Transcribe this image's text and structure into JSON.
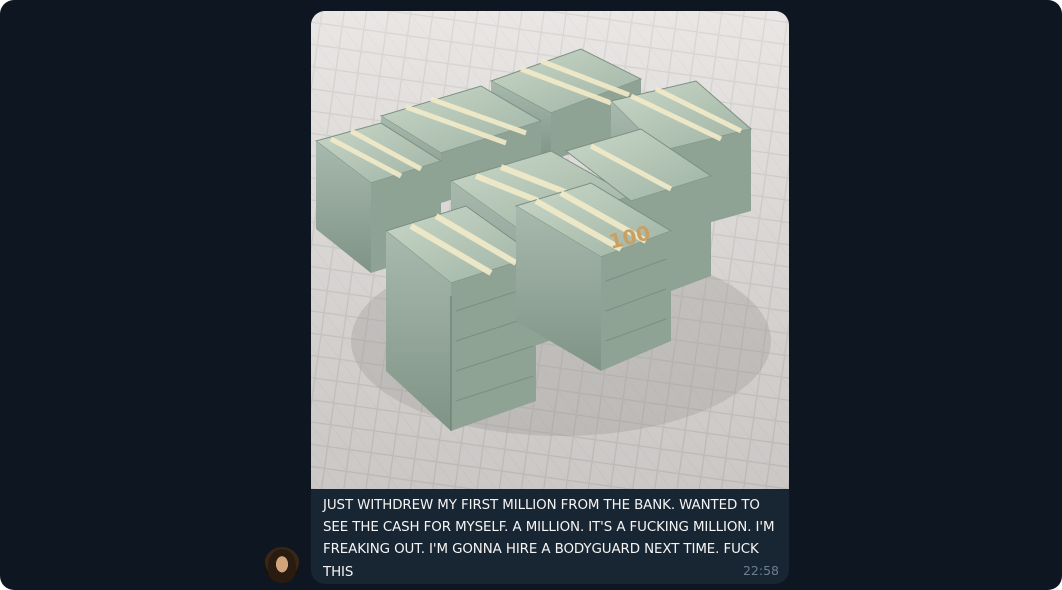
{
  "message": {
    "caption": "JUST WITHDREW MY FIRST MILLION FROM THE BANK. WANTED TO SEE THE CASH FOR MYSELF. A MILLION. IT'S A FUCKING MILLION. I'M FREAKING OUT. I'M GONNA HIRE A BODYGUARD NEXT TIME. FUCK THIS",
    "time": "22:58",
    "banknote_label": "100"
  },
  "colors": {
    "background": "#0e1621",
    "bubble": "#182533",
    "caption_text": "#f5f5f5",
    "time_text": "#6d7f8f"
  }
}
